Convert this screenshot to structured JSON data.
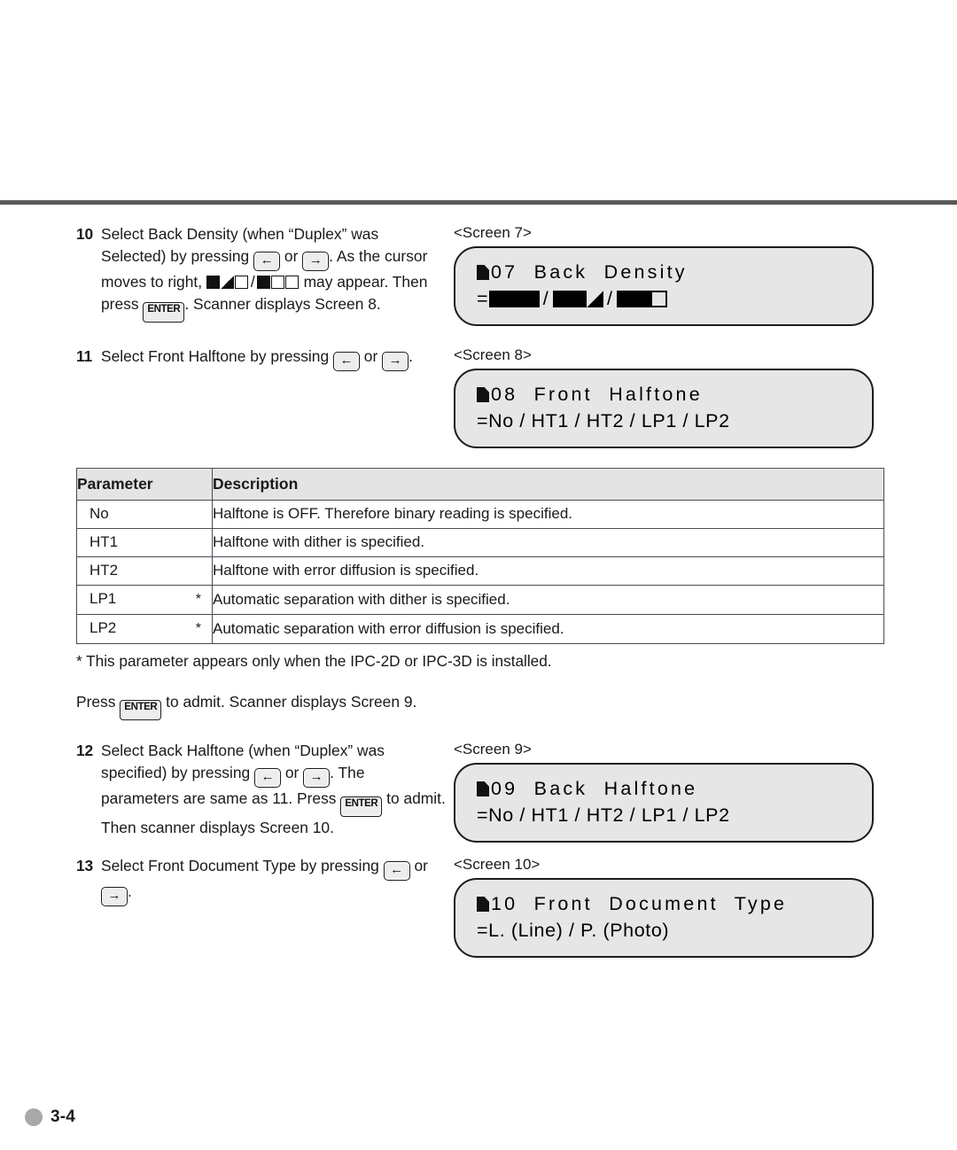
{
  "page": {
    "number": "3-4",
    "footer_dot_color": "#a9a9a9",
    "rule_color": "#595959"
  },
  "steps": [
    {
      "num": "10",
      "caption": "<Screen 7>",
      "text_parts": [
        "Select Back Density (when “Duplex” was Selected) by pressing ",
        " or ",
        ". As the cursor moves to right, ",
        " may appear. Then press ",
        ". Scanner displays Screen 8."
      ],
      "keys": [
        "←",
        "→",
        "ENTER"
      ],
      "inline_squares": [
        "full",
        "half",
        "empty",
        "slash",
        "full",
        "empty",
        "empty"
      ]
    },
    {
      "num": "11",
      "caption": "<Screen 8>",
      "text_parts": [
        "Select Front Halftone by pressing ",
        " or ",
        "."
      ],
      "keys": [
        "←",
        "→"
      ]
    },
    {
      "num": "12",
      "caption": "<Screen 9>",
      "text_parts": [
        "Select Back Halftone (when “Duplex” was specified) by pressing ",
        " or ",
        ". The parameters are same as 11. Press ",
        " to admit. Then scanner displays Screen 10."
      ],
      "keys": [
        "←",
        "→",
        "ENTER"
      ]
    },
    {
      "num": "13",
      "caption": "<Screen 10>",
      "text_parts": [
        "Select Front Document Type by pressing ",
        " or ",
        "."
      ],
      "keys": [
        "←",
        "→"
      ]
    }
  ],
  "lcd_screens": [
    {
      "id": "screen7",
      "caption": "<Screen 7>",
      "line1": "07  Back  Density",
      "line2_type": "squares",
      "line2_prefix": "=",
      "line2_squares": [
        "full",
        "full",
        "full",
        "slash",
        "full",
        "full",
        "half",
        "slash",
        "full",
        "full",
        "empty"
      ]
    },
    {
      "id": "screen8",
      "caption": "<Screen 8>",
      "line1": "08  Front  Halftone",
      "line2_type": "text",
      "line2": "=No / HT1 / HT2 / LP1 / LP2"
    },
    {
      "id": "screen9",
      "caption": "<Screen 9>",
      "line1": "09  Back  Halftone",
      "line2_type": "text",
      "line2": "=No / HT1 / HT2 / LP1 / LP2"
    },
    {
      "id": "screen10",
      "caption": "<Screen 10>",
      "line1": "10  Front  Document  Type",
      "line2_type": "text",
      "line2": "=L. (Line) / P. (Photo)"
    }
  ],
  "table": {
    "headers": [
      "Parameter",
      "Description"
    ],
    "rows": [
      {
        "parameter": "No",
        "star": "",
        "description": "Halftone is OFF. Therefore binary reading is specified."
      },
      {
        "parameter": "HT1",
        "star": "",
        "description": "Halftone with dither is specified."
      },
      {
        "parameter": "HT2",
        "star": "",
        "description": "Halftone with error diffusion is specified."
      },
      {
        "parameter": "LP1",
        "star": "*",
        "description": "Automatic separation with dither is specified."
      },
      {
        "parameter": "LP2",
        "star": "*",
        "description": "Automatic separation with error diffusion is specified."
      }
    ],
    "footnote": "* This parameter appears only when the IPC-2D or IPC-3D is installed."
  },
  "press_enter_note": {
    "before": "Press ",
    "key": "ENTER",
    "after": " to admit. Scanner displays Screen 9."
  }
}
